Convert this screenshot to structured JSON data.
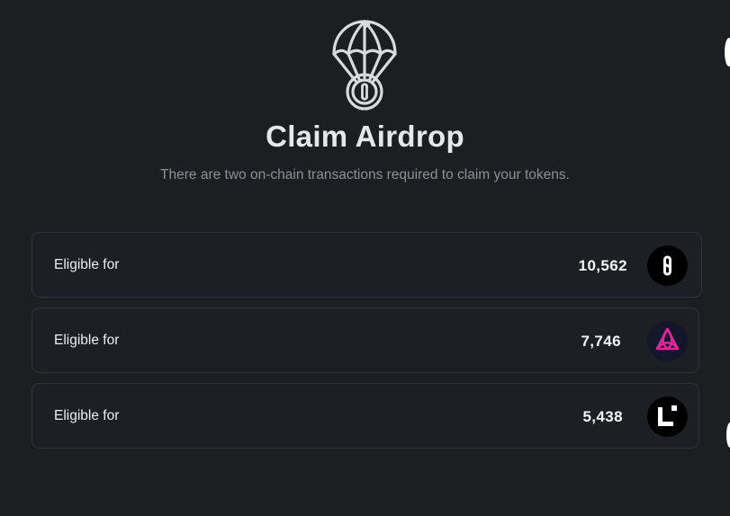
{
  "header": {
    "icon": "parachute-token-icon",
    "title": "Claim Airdrop",
    "subtitle": "There are two on-chain transactions required to claim your tokens."
  },
  "allocations": [
    {
      "label": "Eligible for",
      "amount": "10,562",
      "token_icon": "infinity-chain-token-icon",
      "token_bg": "#000000"
    },
    {
      "label": "Eligible for",
      "amount": "7,746",
      "token_icon": "pink-triad-token-icon",
      "token_bg": "#14162a",
      "accent": "#e0259b"
    },
    {
      "label": "Eligible for",
      "amount": "5,438",
      "token_icon": "l-dot-token-icon",
      "token_bg": "#000000"
    }
  ],
  "colors": {
    "background": "#1c1e22",
    "card_border": "#2f3238",
    "title": "#e6e7ea",
    "subtitle": "#8d9098"
  }
}
